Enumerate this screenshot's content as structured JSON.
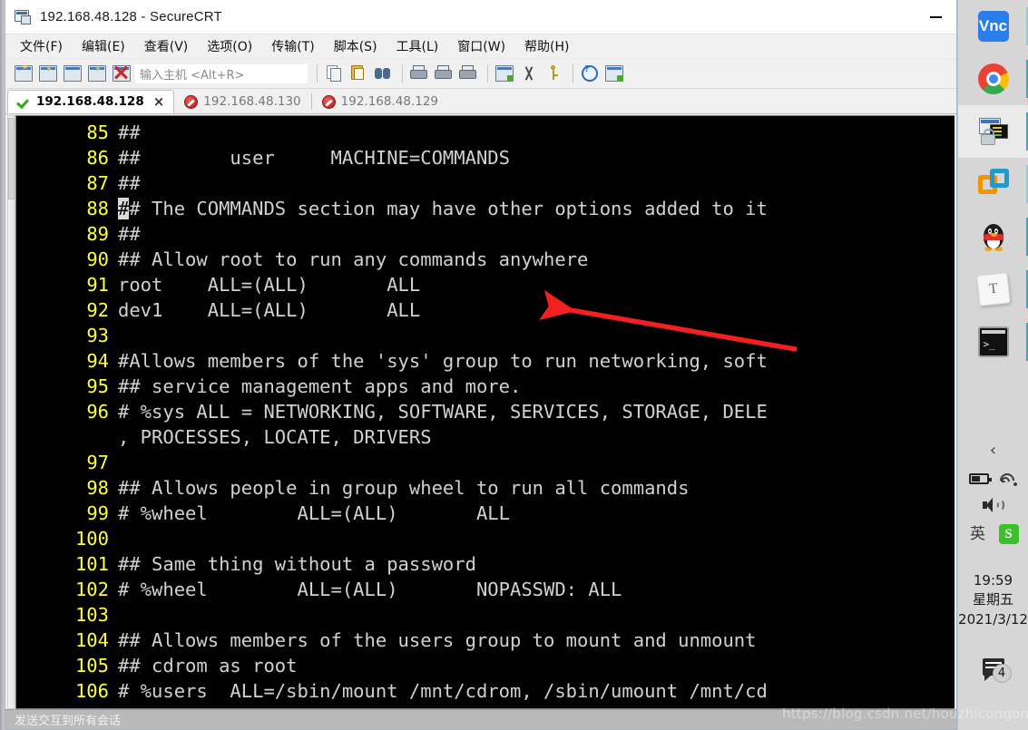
{
  "window": {
    "title": "192.168.48.128 - SecureCRT",
    "icon": "securecrt-icon",
    "minimize_label": "—"
  },
  "menubar": {
    "items": [
      {
        "label": "文件(F)",
        "name": "menu-file"
      },
      {
        "label": "编辑(E)",
        "name": "menu-edit"
      },
      {
        "label": "查看(V)",
        "name": "menu-view"
      },
      {
        "label": "选项(O)",
        "name": "menu-options"
      },
      {
        "label": "传输(T)",
        "name": "menu-transfer"
      },
      {
        "label": "脚本(S)",
        "name": "menu-script"
      },
      {
        "label": "工具(L)",
        "name": "menu-tools"
      },
      {
        "label": "窗口(W)",
        "name": "menu-window"
      },
      {
        "label": "帮助(H)",
        "name": "menu-help"
      }
    ]
  },
  "toolbar": {
    "host_placeholder": "输入主机 <Alt+R>",
    "host_value": "",
    "icons": [
      "new-session-icon",
      "connect-sftp-icon",
      "clone-session-icon",
      "reconnect-icon",
      "disconnect-icon"
    ],
    "icons2": [
      "copy-icon",
      "paste-icon",
      "find-icon"
    ],
    "icons3": [
      "print-screen-icon",
      "log-session-icon",
      "print-icon"
    ],
    "icons4": [
      "session-options-icon",
      "session-settings-icon",
      "key-icon"
    ],
    "icons5": [
      "help-icon",
      "arrange-windows-icon"
    ]
  },
  "tabs": [
    {
      "label": "192.168.48.128",
      "state": "connected",
      "active": true,
      "close": "×"
    },
    {
      "label": "192.168.48.130",
      "state": "disconnected",
      "active": false,
      "close": ""
    },
    {
      "label": "192.168.48.129",
      "state": "disconnected",
      "active": false,
      "close": ""
    }
  ],
  "terminal": {
    "lines": [
      {
        "num": "85",
        "text": "##"
      },
      {
        "num": "86",
        "text": "##        user     MACHINE=COMMANDS"
      },
      {
        "num": "87",
        "text": "##"
      },
      {
        "num": "88",
        "text": "## The COMMANDS section may have other options added to it",
        "cursor_at": 0
      },
      {
        "num": "89",
        "text": "##"
      },
      {
        "num": "90",
        "text": "## Allow root to run any commands anywhere"
      },
      {
        "num": "91",
        "text": "root    ALL=(ALL)       ALL"
      },
      {
        "num": "92",
        "text": "dev1    ALL=(ALL)       ALL"
      },
      {
        "num": "93",
        "text": ""
      },
      {
        "num": "94",
        "text": "#Allows members of the 'sys' group to run networking, soft"
      },
      {
        "num": "95",
        "text": "## service management apps and more."
      },
      {
        "num": "96",
        "text": "# %sys ALL = NETWORKING, SOFTWARE, SERVICES, STORAGE, DELE"
      },
      {
        "num": "",
        "text": ", PROCESSES, LOCATE, DRIVERS"
      },
      {
        "num": "97",
        "text": ""
      },
      {
        "num": "98",
        "text": "## Allows people in group wheel to run all commands"
      },
      {
        "num": "99",
        "text": "# %wheel        ALL=(ALL)       ALL"
      },
      {
        "num": "100",
        "text": ""
      },
      {
        "num": "101",
        "text": "## Same thing without a password"
      },
      {
        "num": "102",
        "text": "# %wheel        ALL=(ALL)       NOPASSWD: ALL"
      },
      {
        "num": "103",
        "text": ""
      },
      {
        "num": "104",
        "text": "## Allows members of the users group to mount and unmount"
      },
      {
        "num": "105",
        "text": "## cdrom as root"
      },
      {
        "num": "106",
        "text": "# %users  ALL=/sbin/mount /mnt/cdrom, /sbin/umount /mnt/cd"
      }
    ],
    "colors": {
      "background": "#000000",
      "line_number": "#ffff3a",
      "text": "#cfd2d4",
      "cursor": "#d8dadc"
    }
  },
  "annotation": {
    "name": "red-arrow",
    "color": "#f32020",
    "points_to_line": "92"
  },
  "statusbar": {
    "text": "发送交互到所有会话"
  },
  "taskbar": {
    "apps": [
      {
        "name": "vnc-viewer-icon",
        "label": "Vnc",
        "active": false
      },
      {
        "name": "chrome-icon",
        "label": "",
        "active": false
      },
      {
        "name": "securecrt-icon",
        "label": "",
        "active": true
      },
      {
        "name": "vmware-icon",
        "label": "",
        "active": false
      },
      {
        "name": "qq-icon",
        "label": "",
        "active": false
      },
      {
        "name": "tim-icon",
        "label": "T",
        "active": false
      },
      {
        "name": "terminal-icon",
        "label": "",
        "active": false
      }
    ],
    "tray": {
      "chevron": "‹",
      "icons": [
        "battery-icon",
        "wifi-icon",
        "volume-icon",
        "ime-icon",
        "sogou-icon"
      ],
      "ime_glyph": "英",
      "sogou_glyph": "S"
    },
    "clock": {
      "time": "19:59",
      "weekday": "星期五",
      "date": "2021/3/12"
    },
    "notification": {
      "name": "action-center-icon",
      "count": "4"
    }
  },
  "watermark": {
    "text": "https://blog.csdn.net/houzhicongone"
  }
}
